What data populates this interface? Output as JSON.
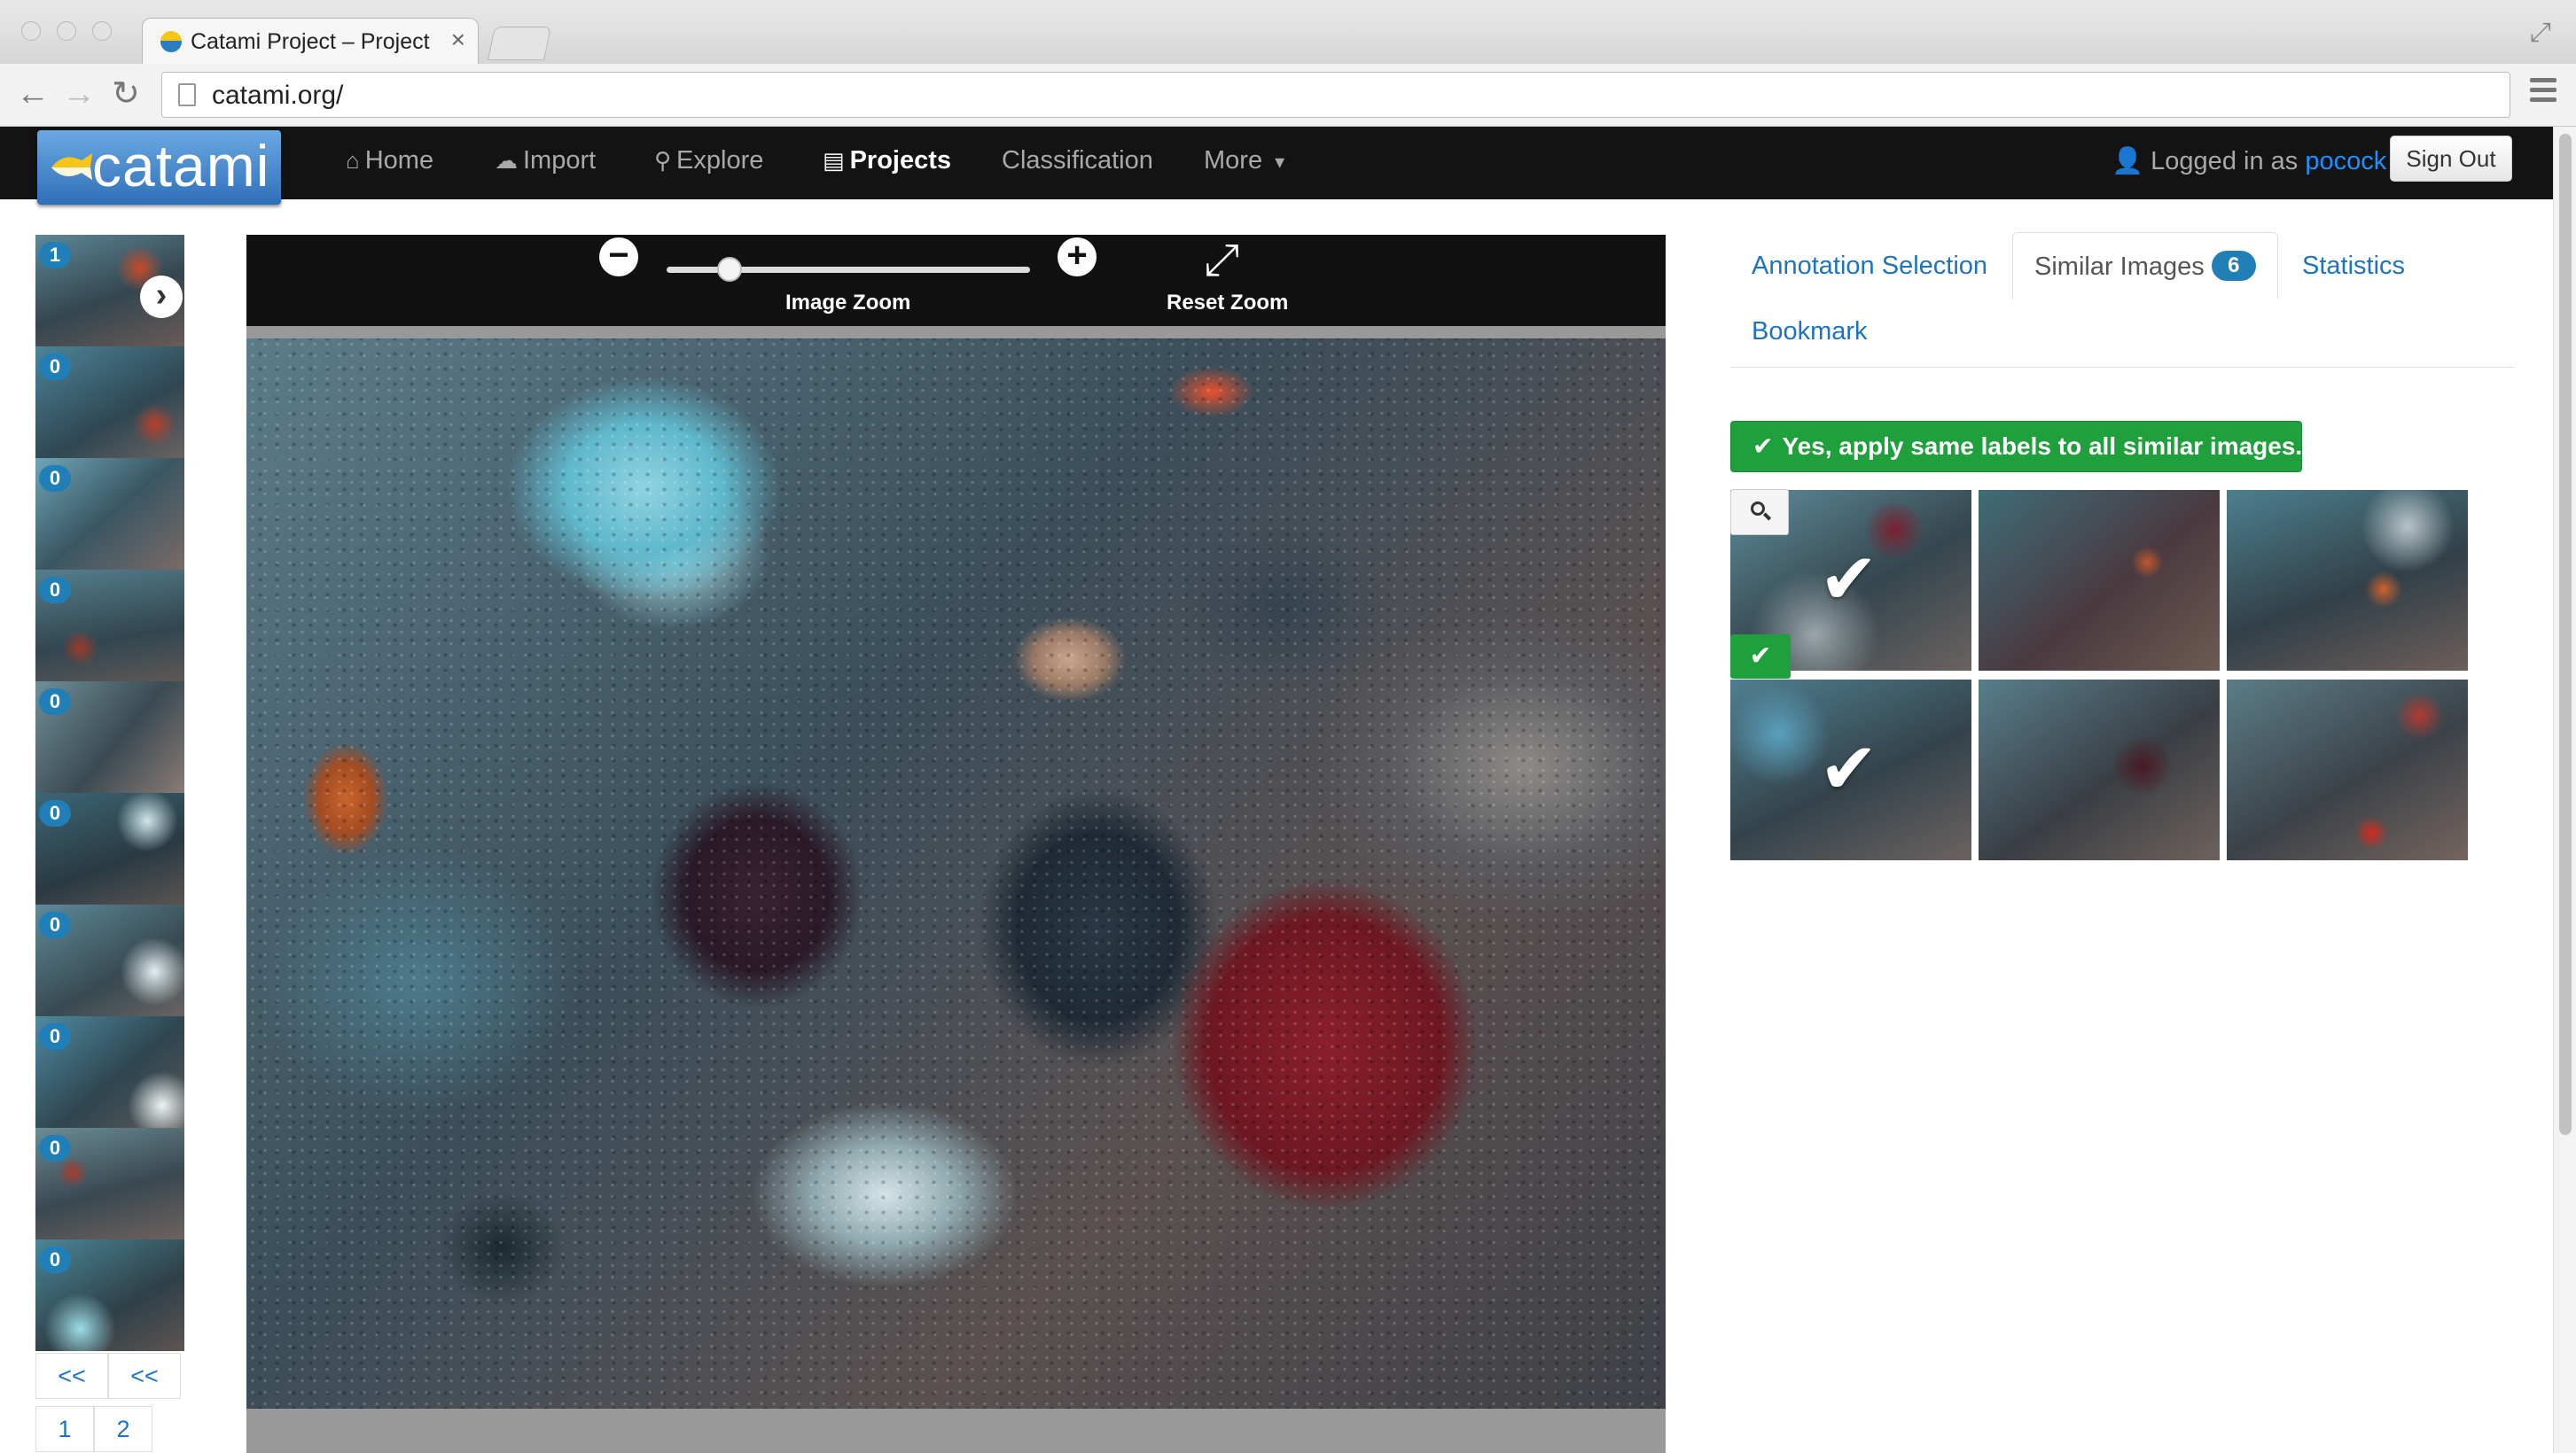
{
  "browser": {
    "tab_title": "Catami Project – Project Li",
    "tab_close": "×",
    "url": "catami.org/"
  },
  "navbar": {
    "brand": "catami",
    "items": [
      {
        "label": "Home",
        "icon": "home-icon",
        "glyph": "⌂"
      },
      {
        "label": "Import",
        "icon": "cloud-upload-icon",
        "glyph": "☁"
      },
      {
        "label": "Explore",
        "icon": "search-icon",
        "glyph": "⚲"
      },
      {
        "label": "Projects",
        "icon": "list-icon",
        "glyph": "▤",
        "active": true
      },
      {
        "label": "Classification",
        "icon": "",
        "glyph": ""
      },
      {
        "label": "More",
        "icon": "caret-down-icon",
        "glyph": "▾"
      }
    ],
    "logged_in_prefix": "Logged in as",
    "username": "pocock",
    "sign_out": "Sign Out"
  },
  "thumbnails": {
    "items": [
      {
        "count": "1"
      },
      {
        "count": "0"
      },
      {
        "count": "0"
      },
      {
        "count": "0"
      },
      {
        "count": "0"
      },
      {
        "count": "0"
      },
      {
        "count": "0"
      },
      {
        "count": "0"
      },
      {
        "count": "0"
      },
      {
        "count": "0"
      }
    ],
    "prev_labels": [
      "<<",
      "<<"
    ],
    "pages": [
      "1",
      "2"
    ]
  },
  "viewer": {
    "zoom_label": "Image Zoom",
    "reset_label": "Reset Zoom",
    "zoom_level": 0.15
  },
  "panel": {
    "tabs": {
      "annotation_selection": "Annotation Selection",
      "similar_images": "Similar Images",
      "similar_count": "6",
      "statistics": "Statistics",
      "bookmark": "Bookmark"
    },
    "apply_button": "Yes, apply same labels to all similar images.",
    "similar_images": [
      {
        "checked": true
      },
      {
        "checked": false
      },
      {
        "checked": false
      },
      {
        "checked": true
      },
      {
        "checked": false
      },
      {
        "checked": false
      }
    ]
  },
  "colors": {
    "accent_blue": "#1e73be",
    "badge_blue": "#1f7fb6",
    "success_green": "#1fa03c",
    "navbar_bg": "#131313"
  }
}
